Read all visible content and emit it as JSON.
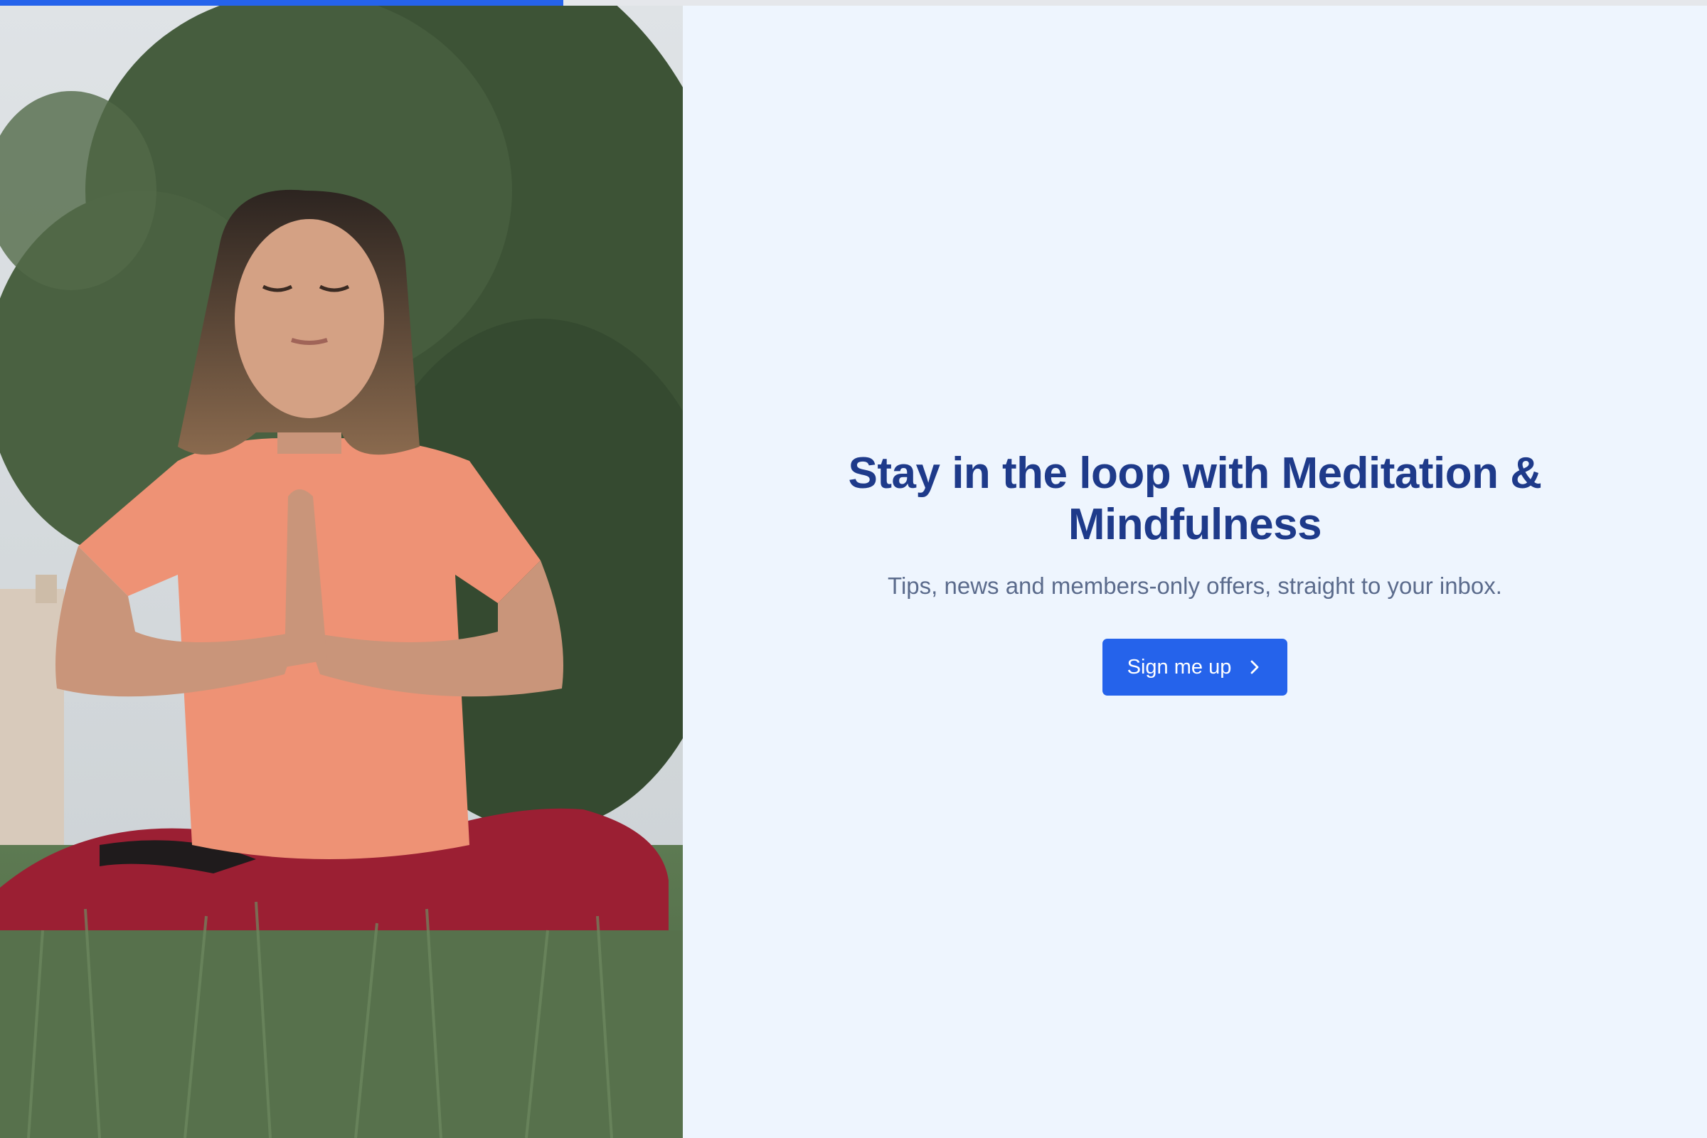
{
  "progress": {
    "percent": 33
  },
  "hero": {
    "image_subject": "woman-meditating-in-grass"
  },
  "main": {
    "headline": "Stay in the loop with Meditation & Mindfulness",
    "subline": "Tips, news and members-only offers, straight to your inbox.",
    "cta_label": "Sign me up",
    "cta_icon": "chevron-right-icon"
  },
  "colors": {
    "accent": "#2563eb",
    "headline": "#1e3a8a",
    "subline": "#5b6b8c",
    "background": "#eef5fe"
  }
}
